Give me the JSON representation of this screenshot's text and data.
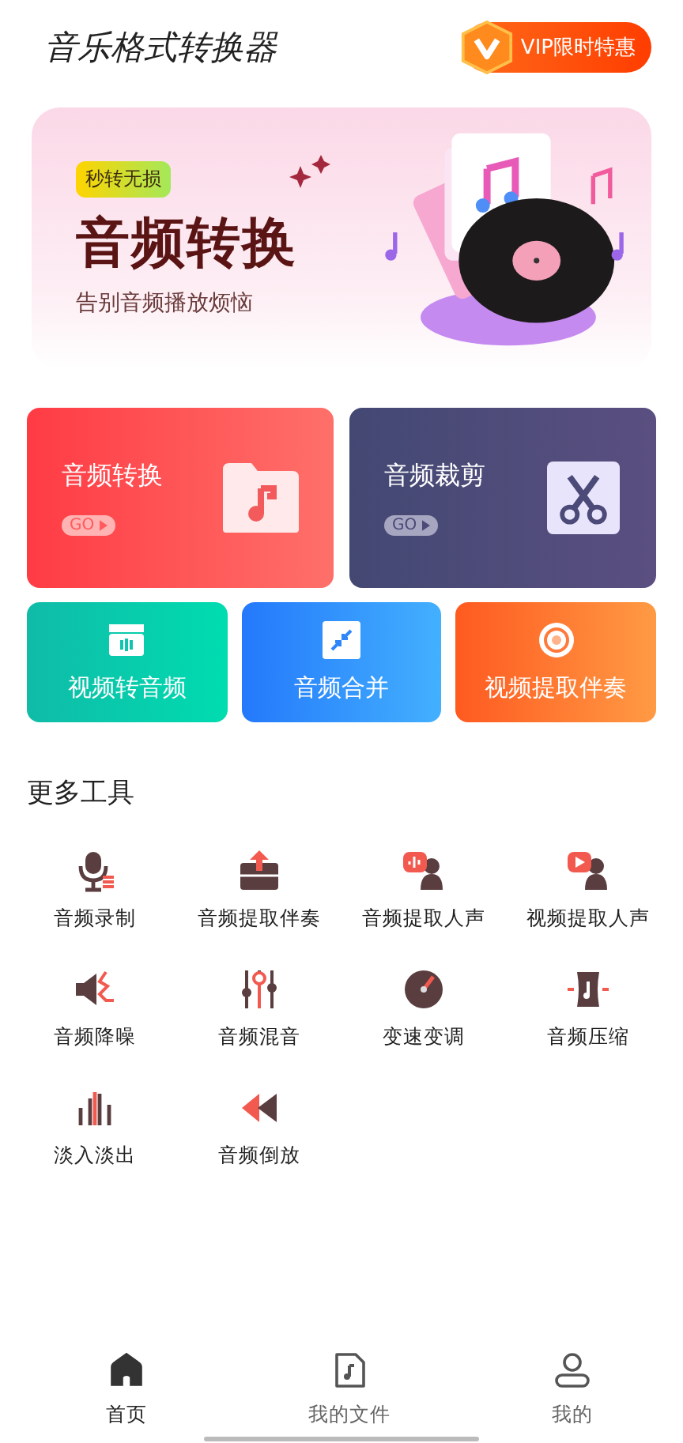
{
  "header": {
    "title": "音乐格式转换器",
    "vip_label": "VIP限时特惠"
  },
  "banner": {
    "tag": "秒转无损",
    "title": "音频转换",
    "subtitle": "告别音频播放烦恼"
  },
  "feature_cards": [
    {
      "title": "音频转换",
      "go": "GO"
    },
    {
      "title": "音频裁剪",
      "go": "GO"
    }
  ],
  "quick_cards": [
    {
      "label": "视频转音频"
    },
    {
      "label": "音频合并"
    },
    {
      "label": "视频提取伴奏"
    }
  ],
  "more_tools": {
    "heading": "更多工具",
    "items": [
      {
        "label": "音频录制"
      },
      {
        "label": "音频提取伴奏"
      },
      {
        "label": "音频提取人声"
      },
      {
        "label": "视频提取人声"
      },
      {
        "label": "音频降噪"
      },
      {
        "label": "音频混音"
      },
      {
        "label": "变速变调"
      },
      {
        "label": "音频压缩"
      },
      {
        "label": "淡入淡出"
      },
      {
        "label": "音频倒放"
      }
    ]
  },
  "tab_bar": [
    {
      "label": "首页",
      "selected": true
    },
    {
      "label": "我的文件",
      "selected": false
    },
    {
      "label": "我的",
      "selected": false
    }
  ]
}
